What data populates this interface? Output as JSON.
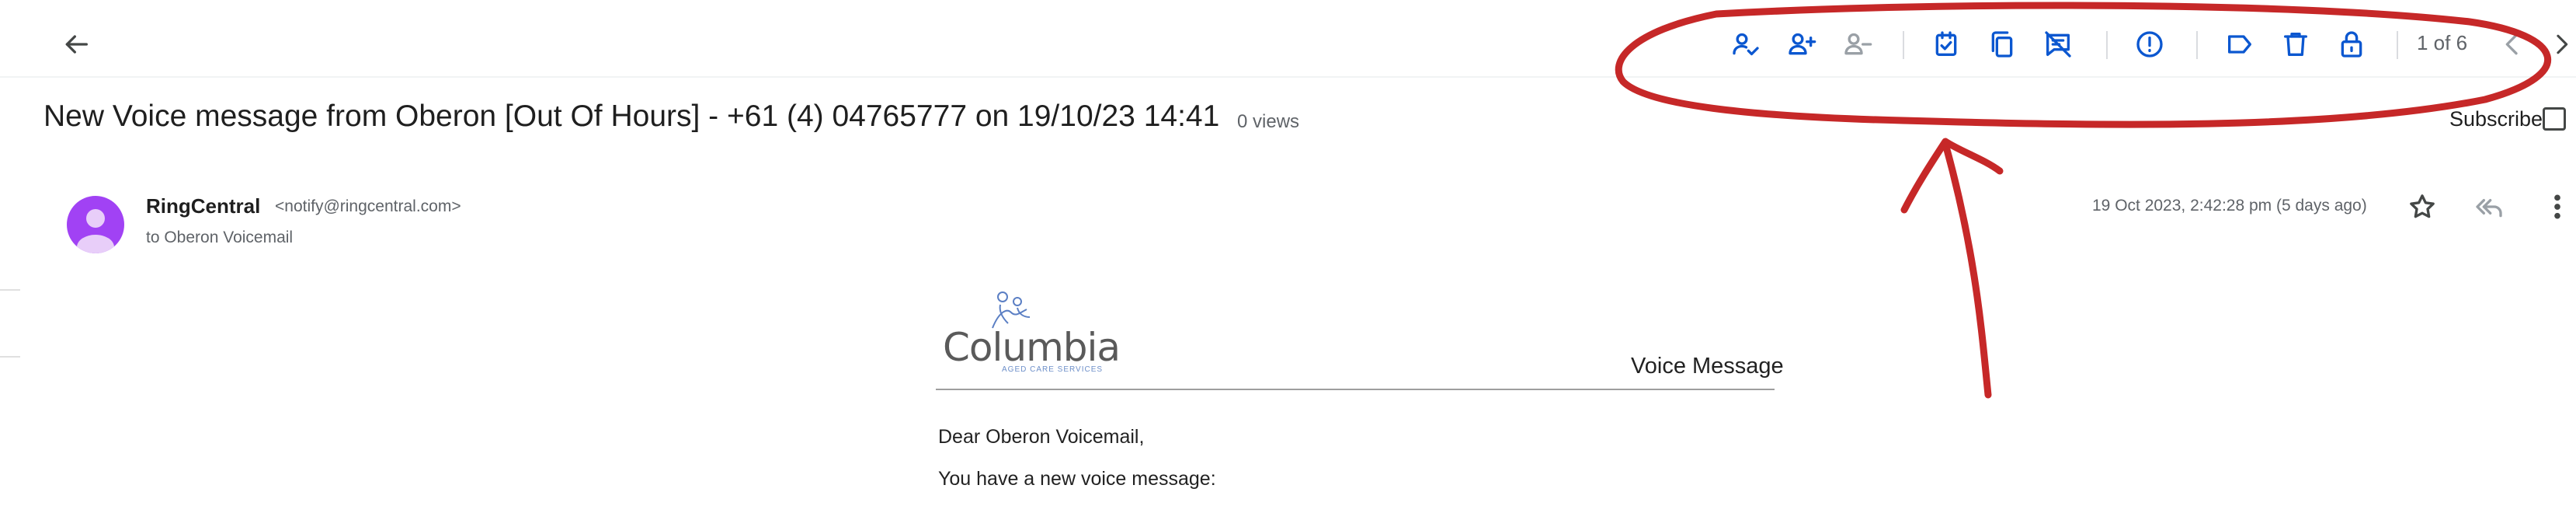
{
  "toolbar": {
    "pager": "1 of 6"
  },
  "message": {
    "subject": "New Voice message from Oberon [Out Of Hours] - +61 (4) 04765777 on 19/10/23 14:41",
    "views": "0 views",
    "subscribe_label": "Subscribe",
    "sender_name": "RingCentral",
    "sender_email": "<notify@ringcentral.com>",
    "to_line": "to Oberon Voicemail",
    "date": "19 Oct 2023, 2:42:28 pm (5 days ago)"
  },
  "email_body": {
    "logo_text": "Columbia",
    "logo_subtext": "AGED CARE SERVICES",
    "voice_label": "Voice Message",
    "greeting": "Dear Oberon Voicemail,",
    "intro": "You have a new voice message:"
  },
  "colors": {
    "accent": "#0b57d0",
    "annotation": "#c62828",
    "avatar": "#a142f4"
  },
  "icons": [
    "back-arrow-icon",
    "assign-to-me-icon",
    "add-person-icon",
    "remove-person-icon",
    "task-check-icon",
    "copy-icon",
    "mark-unread-icon",
    "report-spam-icon",
    "label-icon",
    "delete-icon",
    "lock-icon",
    "chevron-left-icon",
    "chevron-right-icon",
    "star-icon",
    "reply-all-icon",
    "more-vert-icon"
  ]
}
